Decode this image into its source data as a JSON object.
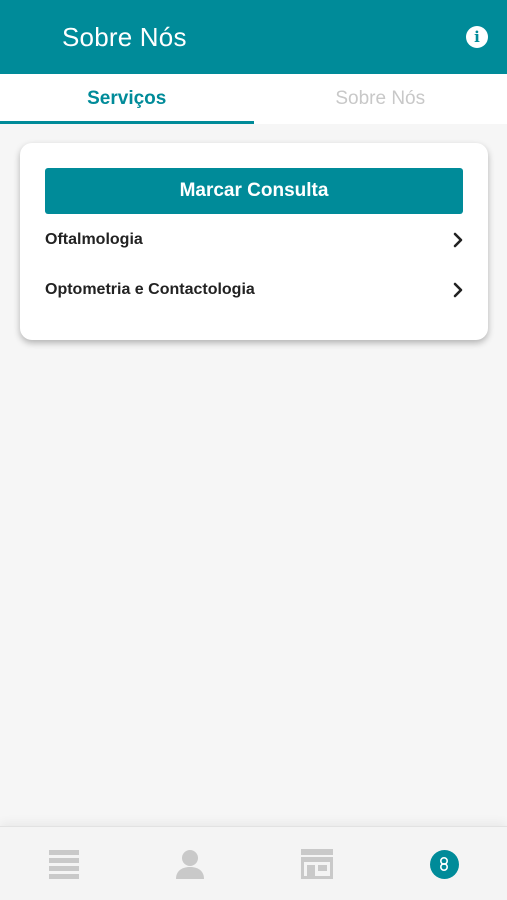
{
  "header": {
    "title": "Sobre Nós",
    "info_icon": "info-icon"
  },
  "tabs": [
    {
      "label": "Serviços",
      "active": true
    },
    {
      "label": "Sobre Nós",
      "active": false
    }
  ],
  "card": {
    "primary_button": "Marcar Consulta",
    "items": [
      {
        "label": "Oftalmologia",
        "icon": "chevron-right-icon"
      },
      {
        "label": "Optometria e Contactologia",
        "icon": "chevron-right-icon"
      }
    ]
  },
  "bottom_nav": {
    "items": [
      {
        "icon": "menu-icon",
        "active": false
      },
      {
        "icon": "user-icon",
        "active": false
      },
      {
        "icon": "store-icon",
        "active": false
      },
      {
        "icon": "link-icon",
        "active": true
      }
    ]
  },
  "colors": {
    "primary": "#008b99",
    "background": "#f6f6f6",
    "inactive_icon": "#c9c9c9",
    "inactive_tab": "#c8c8c8"
  }
}
